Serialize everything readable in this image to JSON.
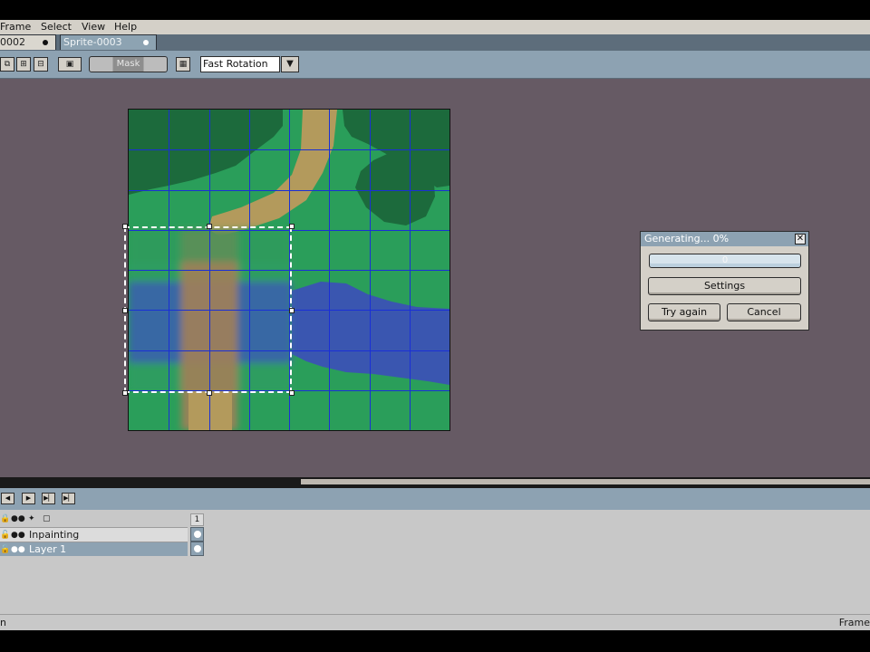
{
  "menu": {
    "items": [
      {
        "label": "Frame",
        "name": "frame"
      },
      {
        "label": "Select",
        "name": "select"
      },
      {
        "label": "View",
        "name": "view"
      },
      {
        "label": "Help",
        "name": "help"
      }
    ]
  },
  "tabs": [
    {
      "label": "0002",
      "active": false
    },
    {
      "label": "Sprite-0003",
      "active": true
    }
  ],
  "toolbar": {
    "mask_label": "Mask",
    "rotation_value": "Fast Rotation"
  },
  "dialog": {
    "title": "Generating... 0%",
    "progress_text": "0",
    "progress": 0,
    "settings_label": "Settings",
    "try_again_label": "Try again",
    "cancel_label": "Cancel"
  },
  "timeline": {
    "frame_number": "1",
    "layers": [
      {
        "name": "Inpainting",
        "selected": false
      },
      {
        "name": "Layer 1",
        "selected": true
      }
    ]
  },
  "status": {
    "left_text": "n",
    "right_text": "Frame"
  },
  "colors": {
    "workspace": "#665a64",
    "grass": "#2a9e5a",
    "tree": "#1c6a3c",
    "water": "#3a56b0",
    "path": "#b39a5c",
    "grid": "#1a2fd6",
    "accent": "#8da2b2"
  }
}
